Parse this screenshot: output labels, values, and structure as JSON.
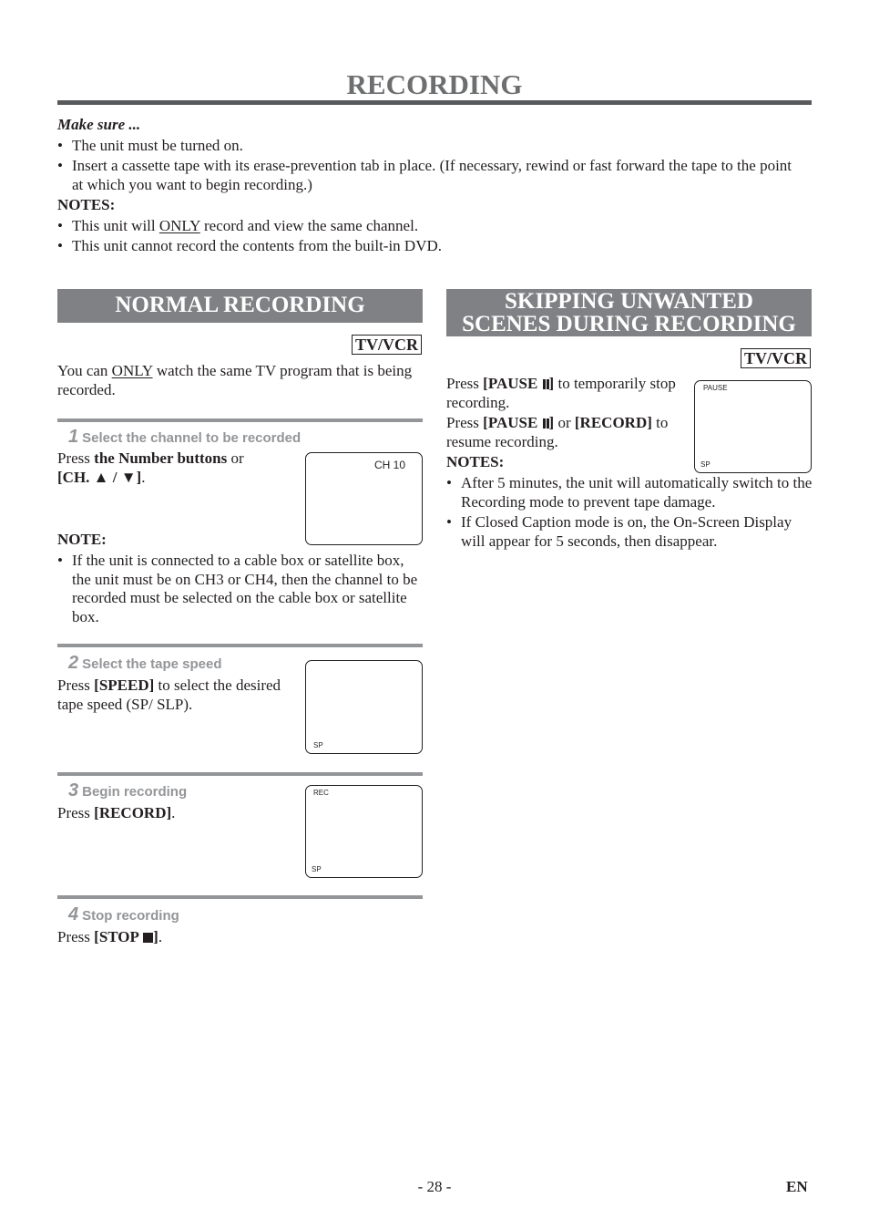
{
  "page": {
    "title": "RECORDING",
    "page_number": "- 28 -",
    "language": "EN"
  },
  "intro": {
    "make_sure_label": "Make sure ...",
    "make_sure_items": [
      "The unit must be turned on.",
      "Insert a cassette tape with its erase-prevention tab in place. (If necessary, rewind or fast forward the tape to the point at which you want to begin recording.)"
    ],
    "notes_label": "NOTES:",
    "notes": [
      {
        "pre": "This unit will ",
        "underline": "ONLY",
        "post": " record and view the same channel."
      },
      {
        "text": "This unit cannot record the contents from the built-in DVD."
      }
    ]
  },
  "normal_recording": {
    "heading": "NORMAL RECORDING",
    "badge": "TV/VCR",
    "intro_pre": "You can ",
    "intro_underline": "ONLY",
    "intro_post": " watch the same TV program that is being recorded.",
    "steps": [
      {
        "number": "1",
        "title": "Select the channel to be recorded",
        "text_pre": "Press ",
        "text_bold": "the Number buttons",
        "text_mid": " or",
        "text_line2": "[CH. ▲ / ▼]",
        "text_post": ".",
        "screen": {
          "top_right": "CH 10"
        },
        "note_label": "NOTE:",
        "note": "If the unit is connected to a cable box or satellite box, the unit must be on CH3 or CH4, then the channel to be recorded must be selected on the cable box or satellite box."
      },
      {
        "number": "2",
        "title": "Select the tape speed",
        "text_pre": "Press ",
        "text_bold": "[SPEED]",
        "text_post": " to select the desired tape speed (SP/ SLP).",
        "screen": {
          "bottom_left": "SP"
        }
      },
      {
        "number": "3",
        "title": "Begin recording",
        "text_pre": "Press ",
        "text_bold": "[RECORD]",
        "text_post": ".",
        "screen": {
          "top_left": "REC",
          "bottom_left": "SP"
        }
      },
      {
        "number": "4",
        "title": "Stop recording",
        "text_pre": "Press ",
        "text_bold": "[STOP",
        "text_bold_end": "]",
        "text_post": "."
      }
    ]
  },
  "skipping": {
    "heading_line1": "SKIPPING UNWANTED",
    "heading_line2": "SCENES DURING RECORDING",
    "badge": "TV/VCR",
    "line1_pre": "Press ",
    "line1_bold": "[PAUSE",
    "line1_post": " to temporarily stop recording.",
    "line2_pre": "Press ",
    "line2_bold": "[PAUSE",
    "line2_mid": " or ",
    "line2_bold2": "[RECORD]",
    "line2_post": " to resume recording.",
    "notes_label": "NOTES:",
    "notes": [
      "After 5 minutes, the unit will automatically switch to the Recording mode to prevent tape damage.",
      "If Closed Caption mode is on, the On-Screen Display will appear for 5 seconds, then disappear."
    ],
    "screen": {
      "top_left": "PAUSE",
      "bottom_left": "SP"
    }
  }
}
